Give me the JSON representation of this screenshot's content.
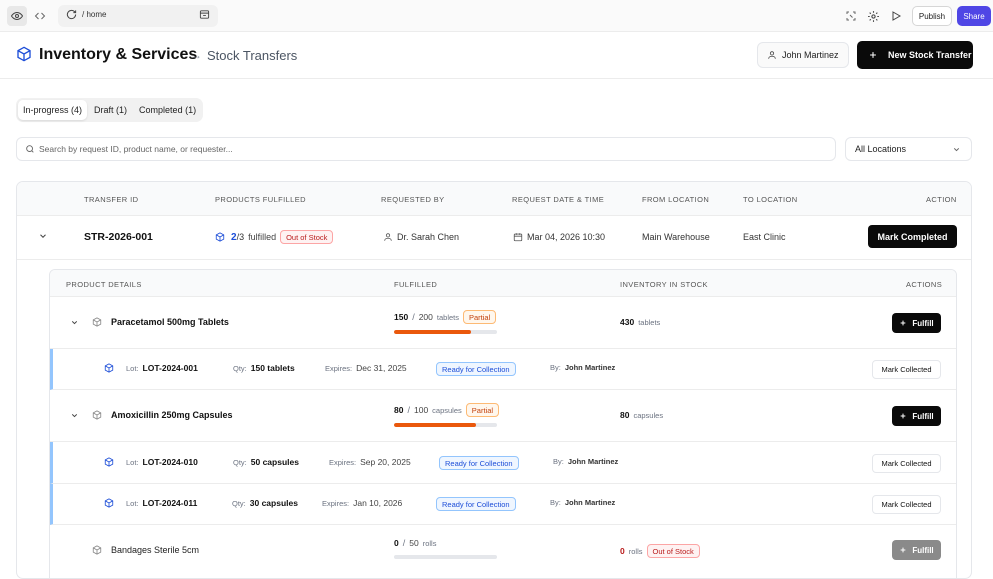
{
  "toolbar": {
    "url": "/ home",
    "publish_label": "Publish",
    "share_label": "Share",
    "accent": "#4f46e5"
  },
  "header": {
    "title": "Inventory & Services",
    "separator": "→",
    "current_page": "Stock Transfers",
    "user_name": "John Martinez",
    "new_button_label": "New Stock Transfer"
  },
  "tabs": [
    {
      "label": "In-progress (4)",
      "active": true
    },
    {
      "label": "Draft (1)",
      "active": false
    },
    {
      "label": "Completed (1)",
      "active": false
    }
  ],
  "search": {
    "placeholder": "Search by request ID, product name, or requester..."
  },
  "location_filter": {
    "selected": "All Locations"
  },
  "table": {
    "columns": [
      "Transfer ID",
      "Products Fulfilled",
      "Requested By",
      "Request Date & Time",
      "From Location",
      "To Location",
      "Action"
    ],
    "row": {
      "transfer_id": "STR-2026-001",
      "fulfilled_count": "2",
      "fulfilled_total": "/3",
      "fulfilled_suffix": "fulfilled",
      "status_badge": "Out of Stock",
      "requested_by": "Dr. Sarah Chen",
      "request_datetime": "Mar 04, 2026 10:30",
      "from_location": "Main Warehouse",
      "to_location": "East Clinic",
      "action_label": "Mark Completed"
    }
  },
  "details": {
    "columns": [
      "Product Details",
      "Fulfilled",
      "Inventory in Stock",
      "Actions"
    ],
    "products": [
      {
        "name": "Paracetamol 500mg Tablets",
        "fulfilled": "150",
        "sep": "/",
        "requested": "200",
        "unit": "tablets",
        "progress": 0.75,
        "badge": "Partial",
        "stock": "430",
        "stock_unit": "tablets",
        "action_label": "Fulfill",
        "lots": [
          {
            "lot_label": "Lot:",
            "lot": "LOT-2024-001",
            "qty_label": "Qty:",
            "qty": "150 tablets",
            "exp_label": "Expires:",
            "expires": "Dec 31, 2025",
            "status": "Ready for Collection",
            "by_label": "By:",
            "by": "John Martinez",
            "action_label": "Mark Collected"
          }
        ]
      },
      {
        "name": "Amoxicillin 250mg Capsules",
        "fulfilled": "80",
        "sep": "/",
        "requested": "100",
        "unit": "capsules",
        "progress": 0.8,
        "badge": "Partial",
        "stock": "80",
        "stock_unit": "capsules",
        "action_label": "Fulfill",
        "lots": [
          {
            "lot_label": "Lot:",
            "lot": "LOT-2024-010",
            "qty_label": "Qty:",
            "qty": "50 capsules",
            "exp_label": "Expires:",
            "expires": "Sep 20, 2025",
            "status": "Ready for Collection",
            "by_label": "By:",
            "by": "John Martinez",
            "action_label": "Mark Collected"
          },
          {
            "lot_label": "Lot:",
            "lot": "LOT-2024-011",
            "qty_label": "Qty:",
            "qty": "30 capsules",
            "exp_label": "Expires:",
            "expires": "Jan 10, 2026",
            "status": "Ready for Collection",
            "by_label": "By:",
            "by": "John Martinez",
            "action_label": "Mark Collected"
          }
        ]
      },
      {
        "name": "Bandages Sterile 5cm",
        "fulfilled": "0",
        "sep": "/",
        "requested": "50",
        "unit": "rolls",
        "progress": 0,
        "stock": "0",
        "stock_unit": "rolls",
        "stock_badge": "Out of Stock",
        "action_label": "Fulfill"
      }
    ]
  }
}
